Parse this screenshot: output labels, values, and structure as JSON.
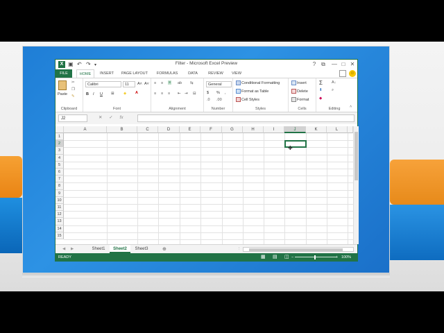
{
  "window": {
    "title": "Filter - Microsoft Excel Preview"
  },
  "qat": {
    "save": "💾",
    "undo": "↶",
    "redo": "↷",
    "customize": "▾"
  },
  "window_buttons": {
    "help": "?",
    "restore": "⧉",
    "minimize": "—",
    "maximize": "□",
    "close": "✕"
  },
  "tabs": [
    "FILE",
    "HOME",
    "INSERT",
    "PAGE LAYOUT",
    "FORMULAS",
    "DATA",
    "REVIEW",
    "VIEW"
  ],
  "active_tab": "HOME",
  "ribbon": {
    "clipboard": {
      "paste": "Paste",
      "label": "Clipboard"
    },
    "font": {
      "name": "Calibri",
      "size": "11",
      "bold": "B",
      "italic": "I",
      "underline": "U",
      "grow": "A˄",
      "shrink": "A˅",
      "label": "Font"
    },
    "alignment": {
      "label": "Alignment"
    },
    "number": {
      "format": "General",
      "currency": "$",
      "percent": "%",
      "comma": ",",
      "label": "Number"
    },
    "styles": {
      "conditional": "Conditional Formatting",
      "table": "Format as Table",
      "cell_styles": "Cell Styles",
      "label": "Styles"
    },
    "cells": {
      "insert": "Insert",
      "delete": "Delete",
      "format": "Format",
      "label": "Cells"
    },
    "editing": {
      "sum": "Σ",
      "label": "Editing"
    }
  },
  "formula_bar": {
    "name_box": "J2",
    "cancel": "✕",
    "enter": "✓",
    "fx": "fx",
    "value": ""
  },
  "columns": [
    "A",
    "B",
    "C",
    "D",
    "E",
    "F",
    "G",
    "H",
    "I",
    "J",
    "K",
    "L"
  ],
  "rows": [
    "1",
    "2",
    "3",
    "4",
    "5",
    "6",
    "7",
    "8",
    "9",
    "10",
    "11",
    "12",
    "13",
    "14",
    "15"
  ],
  "selected_cell": "J2",
  "sheets": [
    "Sheet1",
    "Sheet2",
    "Sheet3"
  ],
  "active_sheet": "Sheet2",
  "add_sheet": "⊕",
  "status": {
    "mode": "READY",
    "zoom": "100%",
    "minus": "−",
    "plus": "+"
  },
  "colors": {
    "excel_green": "#217346",
    "desktop_blue": "#1f7ed6"
  }
}
